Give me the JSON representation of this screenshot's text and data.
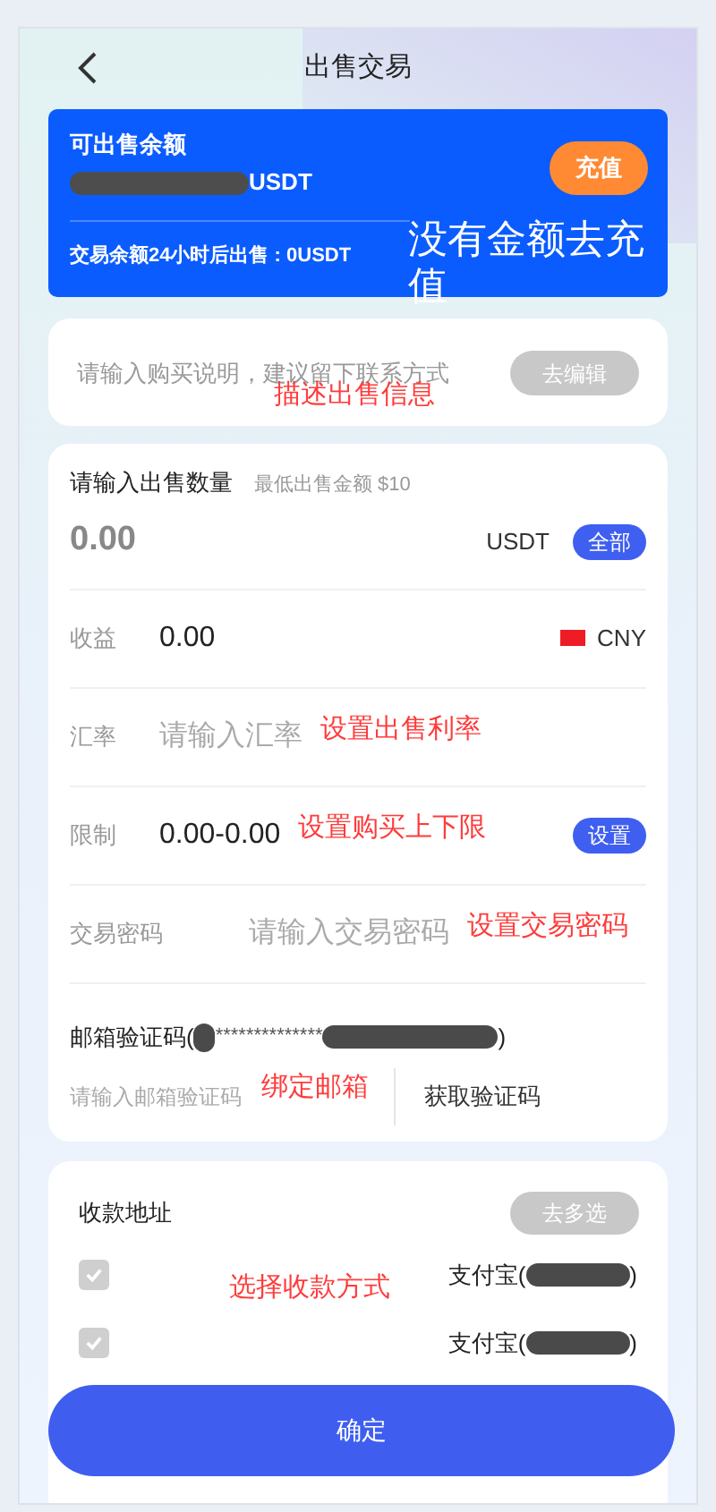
{
  "header": {
    "title": "出售交易"
  },
  "balance": {
    "label": "可出售余额",
    "currency": "USDT",
    "note": "交易余额24小时后出售 : 0USDT",
    "recharge": "充值",
    "annotation": "没有金额去充值"
  },
  "description": {
    "placeholder": "请输入购买说明，建议留下联系方式",
    "button": "去编辑",
    "annotation": "描述出售信息"
  },
  "amount": {
    "label": "请输入出售数量",
    "hint": "最低出售金额 $10",
    "placeholder": "0.00",
    "currency": "USDT",
    "button": "全部"
  },
  "rows": [
    {
      "kind": "value",
      "label": "收益",
      "value": "0.00",
      "currency": "CNY"
    },
    {
      "kind": "input",
      "label": "汇率",
      "placeholder": "请输入汇率",
      "annotation": "设置出售利率"
    },
    {
      "kind": "button",
      "label": "限制",
      "value": "0.00-0.00",
      "button": "设置",
      "annotation": "设置购买上下限"
    },
    {
      "kind": "password",
      "label": "交易密码",
      "placeholder": "请输入交易密码",
      "annotation": "设置交易密码"
    }
  ],
  "email": {
    "label": "邮箱验证码(",
    "masked": "**************",
    "close": ")",
    "placeholder": "请输入邮箱验证码",
    "annotation": "绑定邮箱",
    "button": "获取验证码"
  },
  "address": {
    "title": "收款地址",
    "button": "去多选",
    "annotation": "选择收款方式",
    "items": [
      {
        "label": "支付宝(",
        "close": ")",
        "checked": true
      },
      {
        "label": "支付宝(",
        "close": ")",
        "checked": true
      }
    ]
  },
  "confirm": "确定"
}
